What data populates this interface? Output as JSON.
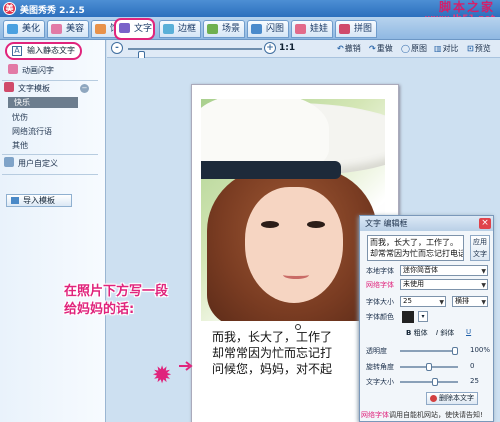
{
  "app": {
    "title": "美图秀秀 2.2.5",
    "logo_glyph": "美"
  },
  "watermark": {
    "line1": "脚本之家",
    "line2": "www.Jb51.net"
  },
  "tabs": [
    {
      "label": "美化",
      "icon": "beautify-icon",
      "color": "#4aa0e0"
    },
    {
      "label": "美容",
      "icon": "cosmetic-icon",
      "color": "#e27aa6"
    },
    {
      "label": "饰品",
      "icon": "accessory-icon",
      "color": "#e8924a"
    },
    {
      "label": "文字",
      "icon": "text-icon",
      "color": "#7a63c9"
    },
    {
      "label": "边框",
      "icon": "frame-icon",
      "color": "#5ab0d8"
    },
    {
      "label": "场景",
      "icon": "scene-icon",
      "color": "#6fb050"
    },
    {
      "label": "闪图",
      "icon": "flash-icon",
      "color": "#4a8acb"
    },
    {
      "label": "娃娃",
      "icon": "doll-icon",
      "color": "#e26a8a"
    },
    {
      "label": "拼图",
      "icon": "collage-icon",
      "color": "#d04a6a"
    }
  ],
  "toolbar": {
    "zoom_out": "-",
    "zoom_in": "+",
    "zoom_ratio": "1:1",
    "undo": "撤销",
    "redo": "重做",
    "original": "原图",
    "compare": "对比",
    "preview": "预览"
  },
  "sidebar": {
    "input_static_text": "输入静态文字",
    "animated_text": "动画闪字",
    "text_templates": "文字模板",
    "template_items": [
      "快乐",
      "忧伤",
      "网络流行语",
      "其他"
    ],
    "selected_template": "快乐",
    "user_custom": "用户自定义",
    "import_template": "导入模板",
    "collapse_glyph": "−"
  },
  "canvas": {
    "caption_lines": "而我，长大了，工作了\n却常常因为忙而忘记打\n问候您，妈妈，对不起",
    "annotation": "在照片下方写一段\n给妈妈的话:",
    "burst_glyph": "✹"
  },
  "editor": {
    "title": "文字 编辑框",
    "close_glyph": "×",
    "text_value": "而我，长大了，工作了。\n却常常因为忙而忘记打电话",
    "apply_label": "应用\n文字",
    "local_font_label": "本地字体",
    "local_font_value": "迷你简音体",
    "net_font_label": "网络字体",
    "net_font_value": "未使用",
    "font_size_label": "字体大小",
    "font_size_value": "25",
    "orientation_value": "横排",
    "font_color_label": "字体颜色",
    "font_color": "#222222",
    "bold": "粗体",
    "italic": "斜体",
    "underline": "U",
    "opacity_label": "透明度",
    "opacity_value": "100%",
    "opacity_fraction": 1.0,
    "rotation_label": "旋转角度",
    "rotation_value": "0",
    "rotation_fraction": 0.5,
    "text_size_label": "文字大小",
    "text_size_value": "25",
    "text_size_fraction": 0.62,
    "delete_label": "删除本文字",
    "footer_pink": "网络字体",
    "footer_text": "调用自能机网站，使快请告知!"
  }
}
